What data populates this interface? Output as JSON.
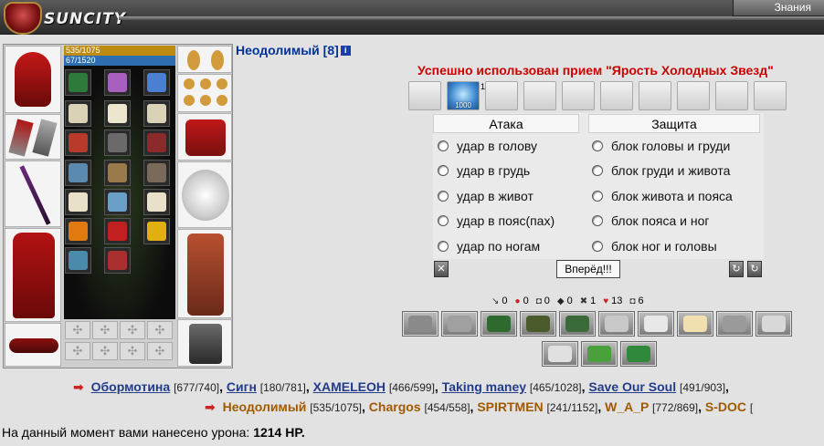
{
  "header": {
    "logo_text": "SUNCITY",
    "knowledge_label": "Знания"
  },
  "character": {
    "name": "Неодолимый",
    "level": "[8]",
    "info_icon": "i",
    "hp": "535/1075",
    "mp": "67/1520"
  },
  "combat": {
    "success_message": "Успешно использован прием \"Ярость Холодных Звезд\"",
    "technique_count": "1000",
    "technique_number": "1",
    "attack_header": "Атака",
    "defense_header": "Защита",
    "attacks": [
      "удар в голову",
      "удар в грудь",
      "удар в живот",
      "удар в пояс(пах)",
      "удар по ногам"
    ],
    "defenses": [
      "блок головы и груди",
      "блок груди и живота",
      "блок живота и пояса",
      "блок пояса и ног",
      "блок ног и головы"
    ],
    "forward_label": "Вперёд!!!",
    "left_btn_icon": "x-icon",
    "right_btn_icons": [
      "refresh-icon",
      "refresh-icon"
    ]
  },
  "stats": [
    {
      "icon": "↘",
      "value": "0",
      "color": "#333333"
    },
    {
      "icon": "●",
      "value": "0",
      "color": "#cc2222"
    },
    {
      "icon": "◘",
      "value": "0",
      "color": "#333333"
    },
    {
      "icon": "◆",
      "value": "0",
      "color": "#222222"
    },
    {
      "icon": "✖",
      "value": "1",
      "color": "#333333"
    },
    {
      "icon": "♥",
      "value": "13",
      "color": "#cc2222"
    },
    {
      "icon": "◘",
      "value": "6",
      "color": "#333333"
    }
  ],
  "team1": [
    {
      "name": "Обормотина",
      "hp": "[677/740]"
    },
    {
      "name": "Сигн",
      "hp": "[180/781]"
    },
    {
      "name": "XAMELEOH",
      "hp": "[466/599]"
    },
    {
      "name": "Taking maney",
      "hp": "[465/1028]"
    },
    {
      "name": "Save Our Soul",
      "hp": "[491/903]"
    }
  ],
  "team1_trailing": ",",
  "team2": [
    {
      "name": "Неодолимый",
      "hp": "[535/1075]"
    },
    {
      "name": "Chargos",
      "hp": "[454/558]"
    },
    {
      "name": "SPIRTMEN",
      "hp": "[241/1152]"
    },
    {
      "name": "W_A_P",
      "hp": "[772/869]"
    },
    {
      "name": "S-DOC",
      "hp": "["
    }
  ],
  "damage": {
    "prefix": "На данный момент вами нанесено урона:",
    "value": "1214 HP."
  }
}
